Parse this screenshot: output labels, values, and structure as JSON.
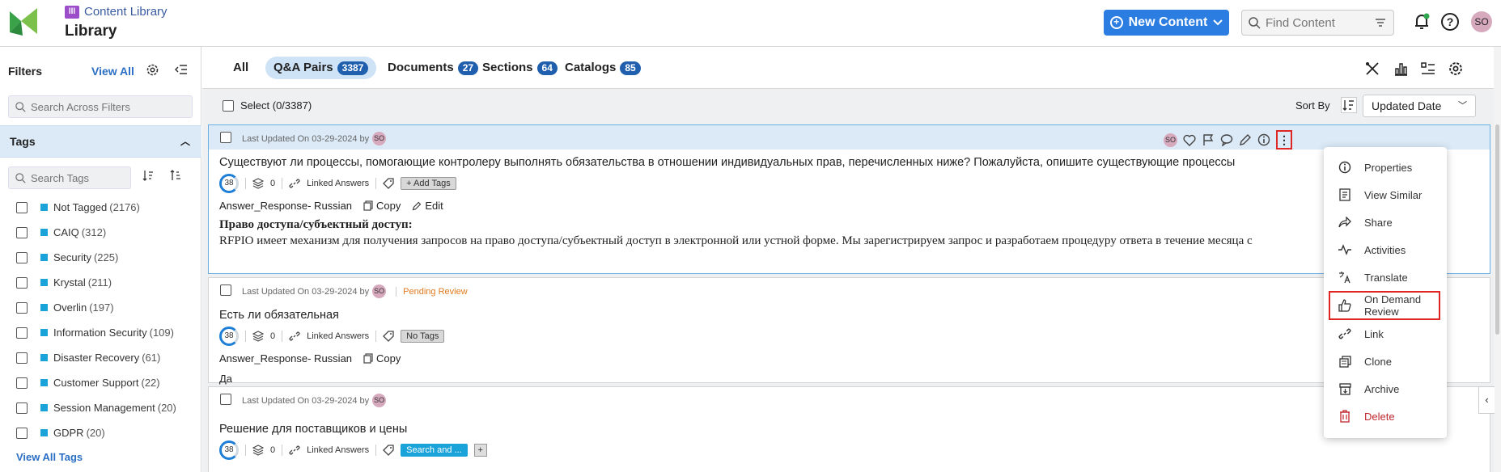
{
  "header": {
    "breadcrumb": "Content Library",
    "title": "Library",
    "new_content_label": "New Content",
    "find_placeholder": "Find Content",
    "avatar": "SO"
  },
  "sidebar": {
    "filters_label": "Filters",
    "view_all_label": "View All",
    "search_filters_placeholder": "Search Across Filters",
    "tags_label": "Tags",
    "search_tags_placeholder": "Search Tags",
    "tags": [
      {
        "name": "Not Tagged",
        "count": "(2176)"
      },
      {
        "name": "CAIQ",
        "count": "(312)"
      },
      {
        "name": "Security",
        "count": "(225)"
      },
      {
        "name": "Krystal",
        "count": "(211)"
      },
      {
        "name": "Overlin",
        "count": "(197)"
      },
      {
        "name": "Information Security",
        "count": "(109)"
      },
      {
        "name": "Disaster Recovery",
        "count": "(61)"
      },
      {
        "name": "Customer Support",
        "count": "(22)"
      },
      {
        "name": "Session Management",
        "count": "(20)"
      },
      {
        "name": "GDPR",
        "count": "(20)"
      }
    ],
    "view_all_tags_label": "View All Tags"
  },
  "tabs": [
    {
      "label": "All",
      "badge": ""
    },
    {
      "label": "Q&A Pairs",
      "badge": "3387"
    },
    {
      "label": "Documents",
      "badge": "27"
    },
    {
      "label": "Sections",
      "badge": "64"
    },
    {
      "label": "Catalogs",
      "badge": "85"
    }
  ],
  "toolbar": {
    "select_label": "Select (0/3387)",
    "sort_by_label": "Sort By",
    "sort_value": "Updated Date"
  },
  "cards": [
    {
      "updated": "Last Updated On 03-29-2024 by",
      "user": "SO",
      "status": "",
      "title": "Существуют ли процессы, помогающие контролеру выполнять обязательства в отношении индивидуальных прав, перечисленных ниже? Пожалуйста, опишите существующие процессы",
      "score": "38",
      "count": "0",
      "linked": "Linked Answers",
      "tag": "+ Add Tags",
      "answer_label": "Answer_Response- Russian",
      "copy": "Copy",
      "edit": "Edit",
      "answer_heading": "Право доступа/субъектный доступ:",
      "answer_text": "RFPIO имеет механизм для получения запросов на право доступа/субъектный доступ в электронной или устной форме. Мы зарегистрируем запрос и разработаем процедуру ответа в течение месяца с"
    },
    {
      "updated": "Last Updated On 03-29-2024 by",
      "user": "SO",
      "status": "Pending Review",
      "title": "Есть ли обязательная",
      "score": "38",
      "count": "0",
      "linked": "Linked Answers",
      "tag": "No Tags",
      "answer_label": "Answer_Response- Russian",
      "copy": "Copy",
      "answer_text": "Да"
    },
    {
      "updated": "Last Updated On 03-29-2024 by",
      "user": "SO",
      "title": "Решение для поставщиков и цены",
      "score": "38",
      "count": "0",
      "linked": "Linked Answers",
      "tag": "Search and ...",
      "plus": "+"
    }
  ],
  "menu": {
    "items": [
      {
        "label": "Properties",
        "icon": "info-icon"
      },
      {
        "label": "View Similar",
        "icon": "document-icon"
      },
      {
        "label": "Share",
        "icon": "share-icon"
      },
      {
        "label": "Activities",
        "icon": "activity-icon"
      },
      {
        "label": "Translate",
        "icon": "translate-icon"
      },
      {
        "label": "On Demand Review",
        "icon": "thumbs-up-icon"
      },
      {
        "label": "Link",
        "icon": "link-icon"
      },
      {
        "label": "Clone",
        "icon": "clone-icon"
      },
      {
        "label": "Archive",
        "icon": "archive-icon"
      },
      {
        "label": "Delete",
        "icon": "trash-icon"
      }
    ]
  },
  "colors": {
    "accent": "#2b7de1",
    "badge": "#1f5fae",
    "tag_square": "#1aa3d8",
    "highlight": "#e02525",
    "pending": "#e07a1f",
    "delete": "#c0262b"
  }
}
